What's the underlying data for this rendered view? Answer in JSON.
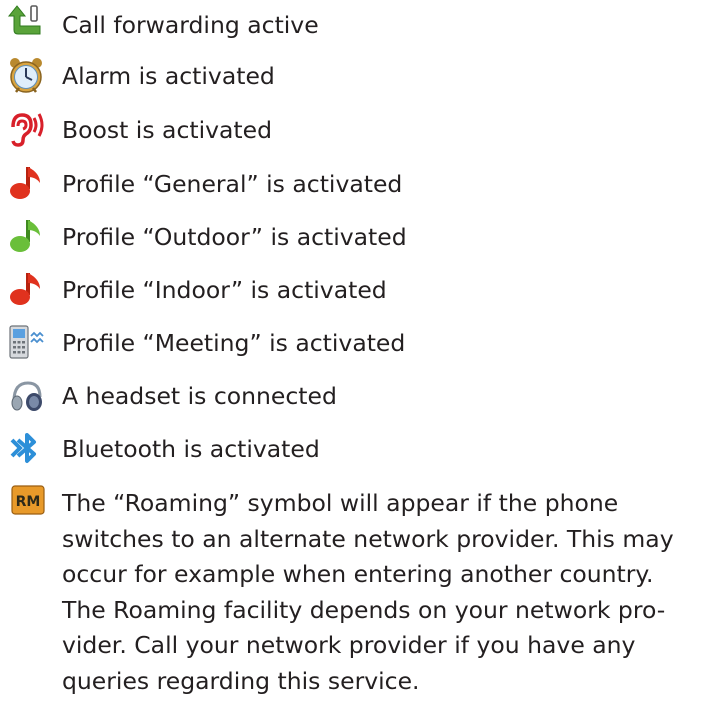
{
  "legend": {
    "items": [
      {
        "icon": "call-forwarding-icon",
        "label": "Call forwarding active"
      },
      {
        "icon": "alarm-clock-icon",
        "label": "Alarm is activated"
      },
      {
        "icon": "boost-ear-icon",
        "label": "Boost is activated"
      },
      {
        "icon": "music-note-red-icon",
        "label": "Profile “General” is activated"
      },
      {
        "icon": "music-note-green-icon",
        "label": "Profile “Outdoor” is activated"
      },
      {
        "icon": "music-note-red-icon",
        "label": "Profile “Indoor” is activated"
      },
      {
        "icon": "vibrating-phone-icon",
        "label": "Profile “Meeting” is activated"
      },
      {
        "icon": "headset-icon",
        "label": "A headset is connected"
      },
      {
        "icon": "bluetooth-icon",
        "label": "Bluetooth is activated"
      }
    ],
    "roaming": {
      "icon": "roaming-icon",
      "icon_text": "RM",
      "lines": [
        "The “Roaming” symbol will appear if the phone",
        "switches to an alternate network provider. This may",
        "occur for example when entering another country.",
        "The Roaming facility depends on your network pro-",
        "vider. Call your network provider if you have any",
        "queries regarding this service."
      ]
    }
  },
  "colors": {
    "text": "#231f20",
    "call_forward_green": "#5aa33a",
    "note_red": "#e0321e",
    "note_green": "#6abf3a",
    "bluetooth_blue": "#2d8fd8",
    "roaming_bg": "#e89a2a",
    "ear_red": "#d8202a"
  }
}
